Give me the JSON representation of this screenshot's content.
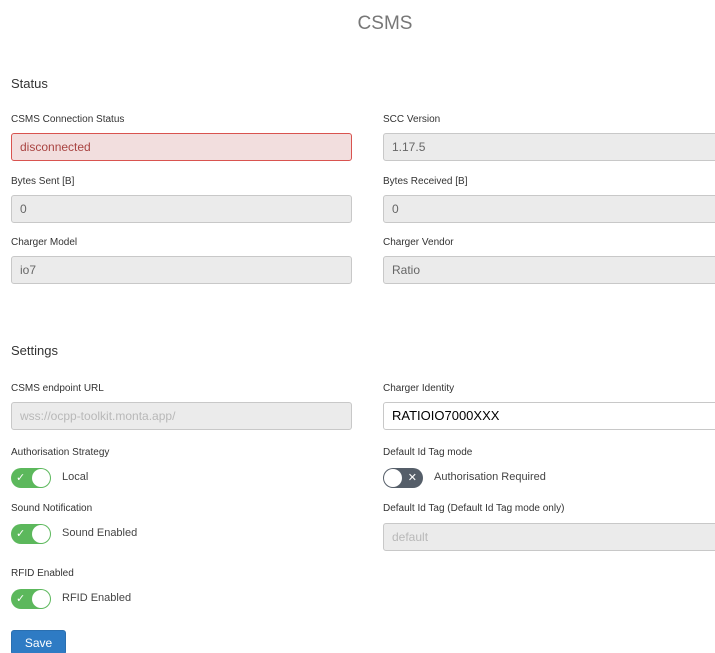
{
  "page": {
    "title": "CSMS",
    "status_heading": "Status",
    "settings_heading": "Settings",
    "save_label": "Save"
  },
  "status": {
    "connection": {
      "label": "CSMS Connection Status",
      "value": "disconnected"
    },
    "scc_version": {
      "label": "SCC Version",
      "value": "1.17.5"
    },
    "bytes_sent": {
      "label": "Bytes Sent [B]",
      "value": "0"
    },
    "bytes_received": {
      "label": "Bytes Received [B]",
      "value": "0"
    },
    "charger_model": {
      "label": "Charger Model",
      "value": "io7"
    },
    "charger_vendor": {
      "label": "Charger Vendor",
      "value": "Ratio"
    }
  },
  "settings": {
    "endpoint_url": {
      "label": "CSMS endpoint URL",
      "placeholder": "wss://ocpp-toolkit.monta.app/"
    },
    "charger_identity": {
      "label": "Charger Identity",
      "value": "RATIOIO7000XXX"
    },
    "authorisation_strategy": {
      "label": "Authorisation Strategy",
      "toggle_label": "Local",
      "enabled": true
    },
    "default_id_tag_mode": {
      "label": "Default Id Tag mode",
      "toggle_label": "Authorisation Required",
      "enabled": false
    },
    "sound_notification": {
      "label": "Sound Notification",
      "toggle_label": "Sound Enabled",
      "enabled": true
    },
    "default_id_tag": {
      "label": "Default Id Tag (Default Id Tag mode only)",
      "placeholder": "default"
    },
    "rfid_enabled": {
      "label": "RFID Enabled",
      "toggle_label": "RFID Enabled",
      "enabled": true
    }
  },
  "icons": {
    "check": "✓",
    "cross": "✕"
  },
  "colors": {
    "toggle_on": "#5cb85c",
    "toggle_off": "#555e69",
    "error": "#d9534f",
    "primary": "#2e7bc4"
  }
}
